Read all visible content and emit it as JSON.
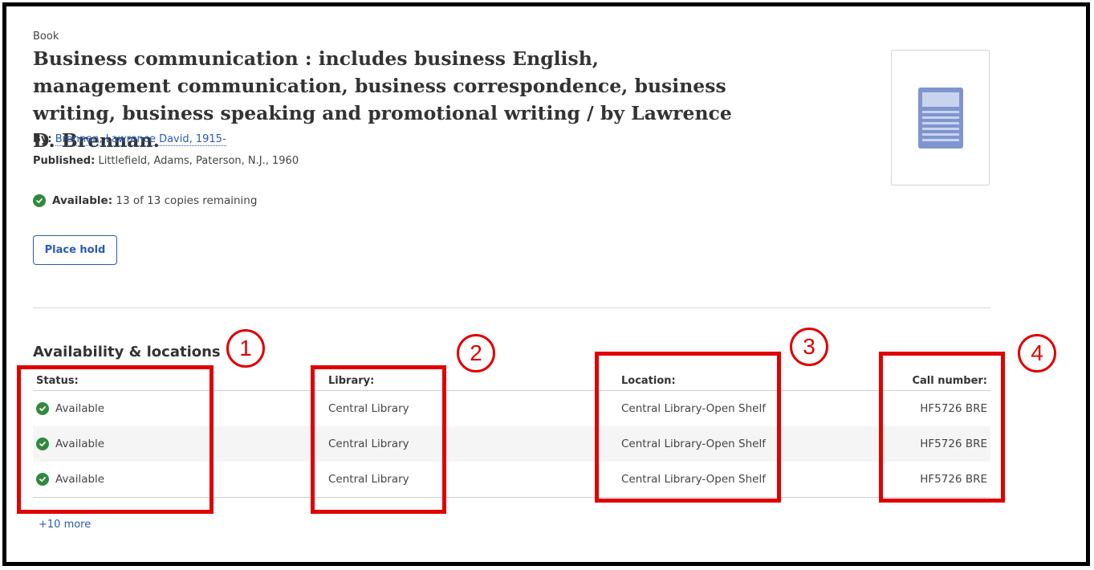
{
  "record": {
    "type": "Book",
    "title": "Business communication : includes business English, management communication, business correspondence, business writing, business speaking and promotional writing / by Lawrence D. Brennan.",
    "by_label": "By:",
    "author": "Brennan, Lawrence David, 1915-",
    "published_label": "Published:",
    "published": "Littlefield, Adams, Paterson, N.J., 1960",
    "availability_label": "Available:",
    "availability_text": "13 of 13 copies remaining",
    "place_hold_label": "Place hold"
  },
  "availability": {
    "section_title": "Availability & locations",
    "headers": {
      "status": "Status:",
      "library": "Library:",
      "location": "Location:",
      "call_number": "Call number:"
    },
    "rows": [
      {
        "status": "Available",
        "library": "Central Library",
        "location": "Central Library-Open Shelf",
        "call_number": "HF5726 BRE"
      },
      {
        "status": "Available",
        "library": "Central Library",
        "location": "Central Library-Open Shelf",
        "call_number": "HF5726 BRE"
      },
      {
        "status": "Available",
        "library": "Central Library",
        "location": "Central Library-Open Shelf",
        "call_number": "HF5726 BRE"
      }
    ],
    "more_link": "+10 more"
  },
  "annotations": {
    "badges": [
      "1",
      "2",
      "3",
      "4"
    ]
  },
  "icons": {
    "available": "check-circle-icon",
    "cover": "book-cover-placeholder-icon"
  },
  "colors": {
    "accent": "#2a5ab4",
    "available_green": "#2f8a3c",
    "annotation_red": "#e00000",
    "cover_icon": "#7f95cf"
  }
}
